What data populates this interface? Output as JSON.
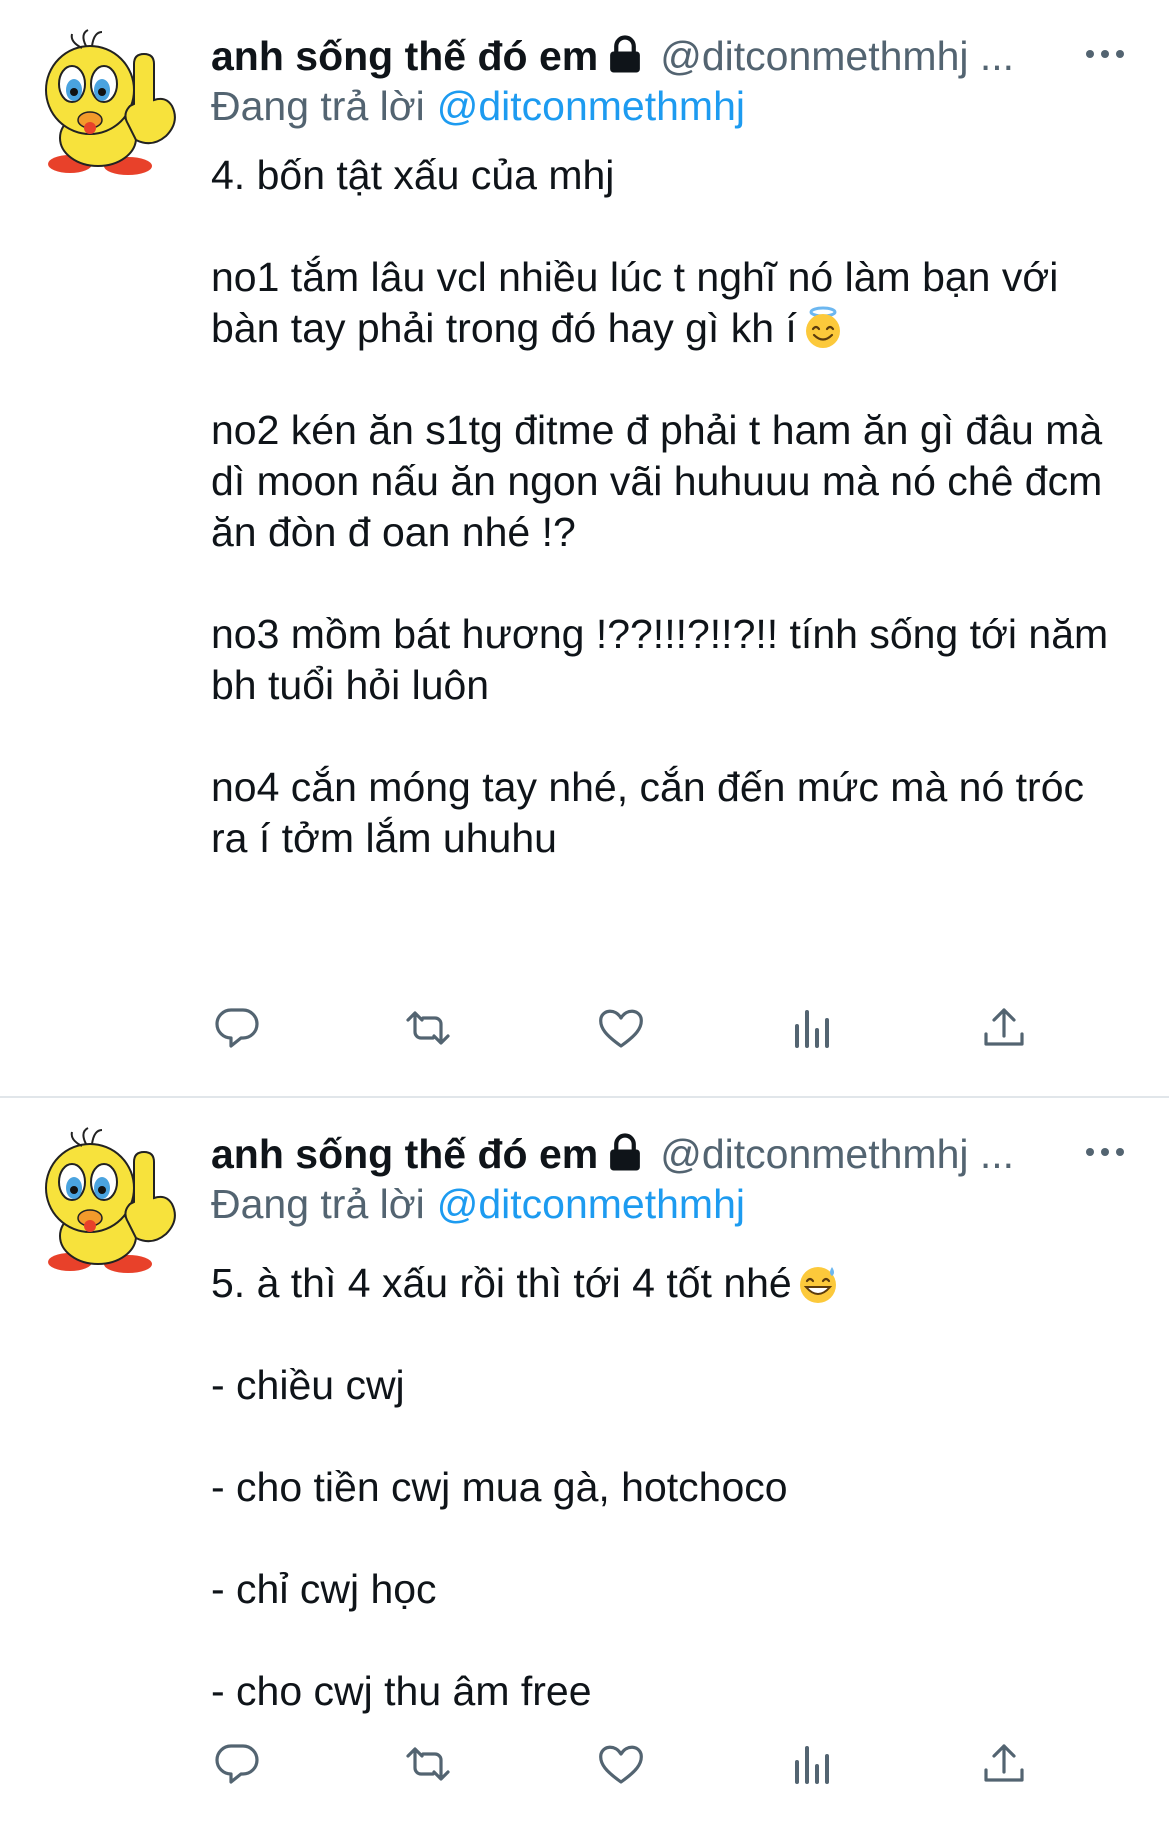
{
  "tweets": [
    {
      "author": {
        "name": "anh sống thế đó em",
        "handle": "@ditconmethmhj ..."
      },
      "replying": {
        "prefix": "Đang trả lời",
        "mention": "@ditconmethmhj"
      },
      "paragraphs": [
        "4. bốn tật xấu của mhj",
        "no1 tắm lâu vcl nhiều lúc t nghĩ nó làm bạn với bàn tay phải trong đó hay gì kh í",
        "no2 kén ăn s1tg đitme đ phải t ham ăn gì đâu mà dì moon nấu ăn ngon vãi huhuuu mà nó chê đcm ăn đòn đ oan nhé !?",
        "no3 mồm bát hương !??!!!?!!?!! tính sống tới năm bh tuổi hỏi luôn",
        "no4 cắn móng tay nhé, cắn đến mức mà nó tróc ra í tởm lắm uhuhu"
      ],
      "emoji": "smiling-face-with-halo"
    },
    {
      "author": {
        "name": "anh sống thế đó em",
        "handle": "@ditconmethmhj ..."
      },
      "replying": {
        "prefix": "Đang trả lời",
        "mention": "@ditconmethmhj"
      },
      "paragraphs": [
        "5. à thì 4 xấu rồi thì tới 4 tốt nhé",
        "- chiều cwj",
        "- cho tiền cwj mua gà, hotchoco",
        "- chỉ cwj học",
        "- cho cwj thu âm free"
      ],
      "emoji": "grinning-face-with-sweat"
    }
  ],
  "colors": {
    "text": "#0f1419",
    "muted": "#536471",
    "link": "#1d9bf0",
    "divider": "#e1e6ea"
  },
  "icons": [
    "more-icon",
    "lock-icon",
    "reply-icon",
    "retweet-icon",
    "like-icon",
    "analytics-icon",
    "share-icon"
  ]
}
